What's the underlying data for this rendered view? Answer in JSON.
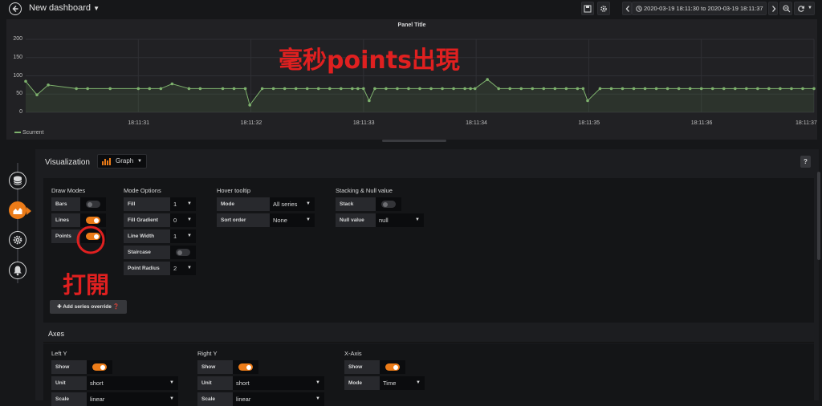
{
  "topbar": {
    "title": "New dashboard",
    "time_range": "2020-03-19 18:11:30 to 2020-03-19 18:11:37"
  },
  "panel": {
    "title": "Panel Title",
    "annotation": "毫秒points出現",
    "legend": "Scurrent",
    "colors": {
      "series": "#7eb26d",
      "annotation": "#e02020"
    }
  },
  "chart_data": {
    "type": "line",
    "title": "Panel Title",
    "xlabel": "",
    "ylabel": "",
    "ylim": [
      0,
      200
    ],
    "y_ticks": [
      "200",
      "150",
      "100",
      "50",
      "0"
    ],
    "x_ticks": [
      "18:11:31",
      "18:11:32",
      "18:11:33",
      "18:11:34",
      "18:11:35",
      "18:11:36",
      "18:11:37"
    ],
    "grid": true,
    "legend_position": "bottom-left",
    "series": [
      {
        "name": "Scurrent",
        "x": [
          30.0,
          30.1,
          30.2,
          30.45,
          30.55,
          30.75,
          31.0,
          31.1,
          31.2,
          31.3,
          31.45,
          31.55,
          31.75,
          31.85,
          31.95,
          31.99,
          32.1,
          32.2,
          32.3,
          32.4,
          32.5,
          32.6,
          32.7,
          32.8,
          32.9,
          32.95,
          33.0,
          33.05,
          33.1,
          33.2,
          33.3,
          33.4,
          33.5,
          33.6,
          33.7,
          33.8,
          33.9,
          33.95,
          33.99,
          34.1,
          34.2,
          34.3,
          34.4,
          34.5,
          34.6,
          34.7,
          34.8,
          34.9,
          34.95,
          34.99,
          35.1,
          35.2,
          35.3,
          35.4,
          35.5,
          35.6,
          35.7,
          35.8,
          35.9,
          36.0,
          36.1,
          36.2,
          36.3,
          36.4,
          36.5,
          36.6,
          36.7,
          36.8,
          36.9,
          37.0
        ],
        "y": [
          85,
          48,
          75,
          65,
          65,
          65,
          65,
          65,
          65,
          78,
          65,
          65,
          65,
          65,
          65,
          20,
          65,
          65,
          65,
          65,
          65,
          65,
          65,
          65,
          65,
          65,
          65,
          32,
          65,
          65,
          65,
          65,
          65,
          65,
          65,
          65,
          65,
          65,
          65,
          90,
          65,
          65,
          65,
          65,
          65,
          65,
          65,
          65,
          65,
          32,
          65,
          65,
          65,
          65,
          65,
          65,
          65,
          65,
          65,
          65,
          65,
          65,
          65,
          65,
          65,
          65,
          65,
          65,
          65,
          65
        ]
      }
    ]
  },
  "editor": {
    "viz_label": "Visualization",
    "viz_type": "Graph",
    "help": "?",
    "draw_modes": {
      "heading": "Draw Modes",
      "bars": "Bars",
      "bars_on": false,
      "lines": "Lines",
      "lines_on": true,
      "points": "Points",
      "points_on": true
    },
    "mode_options": {
      "heading": "Mode Options",
      "fill": "Fill",
      "fill_val": "1",
      "fill_gradient": "Fill Gradient",
      "fill_gradient_val": "0",
      "line_width": "Line Width",
      "line_width_val": "1",
      "staircase": "Staircase",
      "staircase_on": false,
      "point_radius": "Point Radius",
      "point_radius_val": "2"
    },
    "hover_tooltip": {
      "heading": "Hover tooltip",
      "mode": "Mode",
      "mode_val": "All series",
      "sort_order": "Sort order",
      "sort_order_val": "None"
    },
    "stacking": {
      "heading": "Stacking & Null value",
      "stack": "Stack",
      "stack_on": false,
      "null_value": "Null value",
      "null_value_val": "null"
    },
    "annotation": "打開",
    "add_override": "Add series override",
    "axes": {
      "title": "Axes",
      "left_y": {
        "heading": "Left Y",
        "show": "Show",
        "unit": "Unit",
        "unit_val": "short",
        "scale": "Scale",
        "scale_val": "linear"
      },
      "right_y": {
        "heading": "Right Y",
        "show": "Show",
        "unit": "Unit",
        "unit_val": "short",
        "scale": "Scale",
        "scale_val": "linear"
      },
      "x_axis": {
        "heading": "X-Axis",
        "show": "Show",
        "mode": "Mode",
        "mode_val": "Time"
      }
    }
  }
}
